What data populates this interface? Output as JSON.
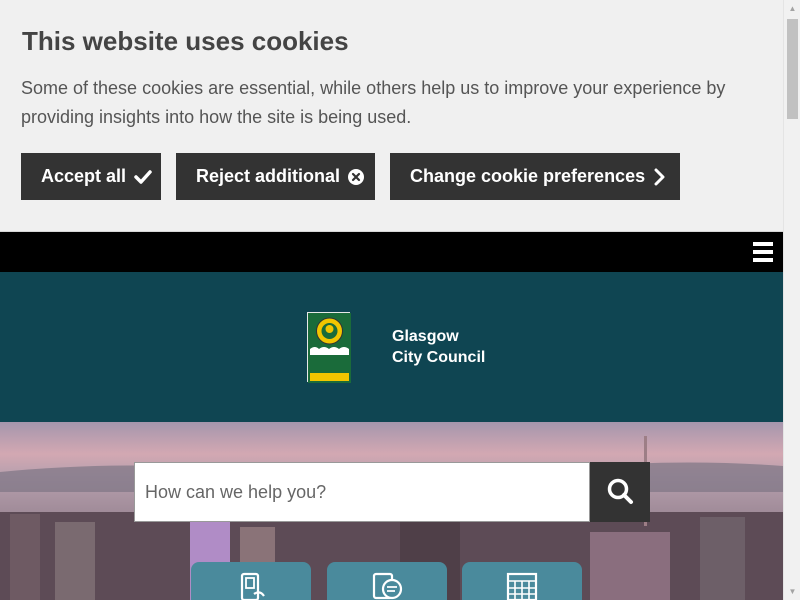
{
  "cookie_banner": {
    "title": "This website uses cookies",
    "text": "Some of these cookies are essential, while others help us to improve your experience by providing insights into how the site is being used.",
    "accept_label": "Accept all",
    "reject_label": "Reject additional",
    "prefs_label": "Change cookie preferences"
  },
  "nav": {
    "menu_icon": "hamburger-menu-icon"
  },
  "header": {
    "org_line1": "Glasgow",
    "org_line2": "City Council",
    "crest_text": "Glasgow",
    "crest_subtext": "CITY COUNCIL",
    "colors": {
      "header_bg": "#0f4552",
      "crest_green": "#1a6b3a",
      "crest_yellow": "#f2c500"
    }
  },
  "search": {
    "placeholder": "How can we help you?",
    "icon": "search-icon"
  },
  "quick_links": [
    {
      "icon": "payment-card-icon"
    },
    {
      "icon": "report-chat-icon"
    },
    {
      "icon": "calendar-icon"
    }
  ]
}
